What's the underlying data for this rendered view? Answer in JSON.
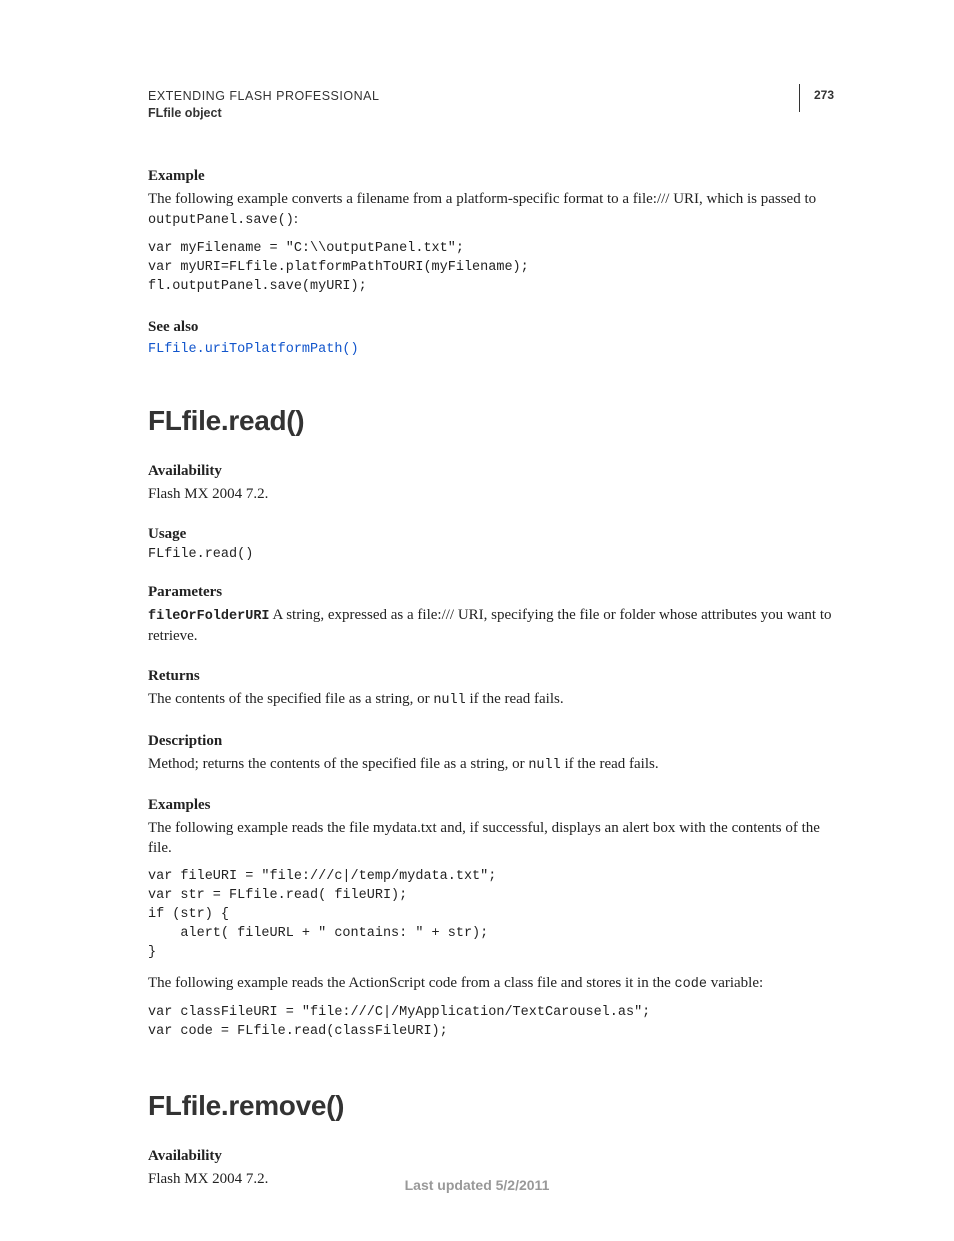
{
  "header": {
    "title": "EXTENDING FLASH PROFESSIONAL",
    "object": "FLfile object",
    "page_number": "273"
  },
  "section1": {
    "example_heading": "Example",
    "example_intro_a": "The following example converts a filename from a platform-specific format to a file:/// URI, which is passed to ",
    "example_intro_code": "outputPanel.save()",
    "example_intro_b": ":",
    "code1": "var myFilename = \"C:\\\\outputPanel.txt\";\nvar myURI=FLfile.platformPathToURI(myFilename);\nfl.outputPanel.save(myURI);",
    "seealso_heading": "See also",
    "seealso_link": "FLfile.uriToPlatformPath()"
  },
  "flfile_read": {
    "title": "FLfile.read()",
    "availability_heading": "Availability",
    "availability_text": "Flash MX 2004 7.2.",
    "usage_heading": "Usage",
    "usage_code": "FLfile.read()",
    "parameters_heading": "Parameters",
    "param_name": "fileOrFolderURI",
    "param_desc": "  A string, expressed as a file:/// URI, specifying the file or folder whose attributes you want to retrieve.",
    "returns_heading": "Returns",
    "returns_text_a": "The contents of the specified file as a string, or ",
    "returns_code": "null",
    "returns_text_b": " if the read fails.",
    "description_heading": "Description",
    "description_text_a": "Method; returns the contents of the specified file as a string, or ",
    "description_code": "null",
    "description_text_b": " if the read fails.",
    "examples_heading": "Examples",
    "examples_intro": "The following example reads the file mydata.txt and, if successful, displays an alert box with the contents of the file.",
    "examples_code1": "var fileURI = \"file:///c|/temp/mydata.txt\";\nvar str = FLfile.read( fileURI);\nif (str) {\n    alert( fileURL + \" contains: \" + str);\n}",
    "examples_intro2_a": "The following example reads the ActionScript code from a class file and stores it in the ",
    "examples_intro2_code": "code",
    "examples_intro2_b": " variable:",
    "examples_code2": "var classFileURI = \"file:///C|/MyApplication/TextCarousel.as\";\nvar code = FLfile.read(classFileURI);"
  },
  "flfile_remove": {
    "title": "FLfile.remove()",
    "availability_heading": "Availability",
    "availability_text": "Flash MX 2004 7.2."
  },
  "footer": {
    "text": "Last updated 5/2/2011"
  }
}
